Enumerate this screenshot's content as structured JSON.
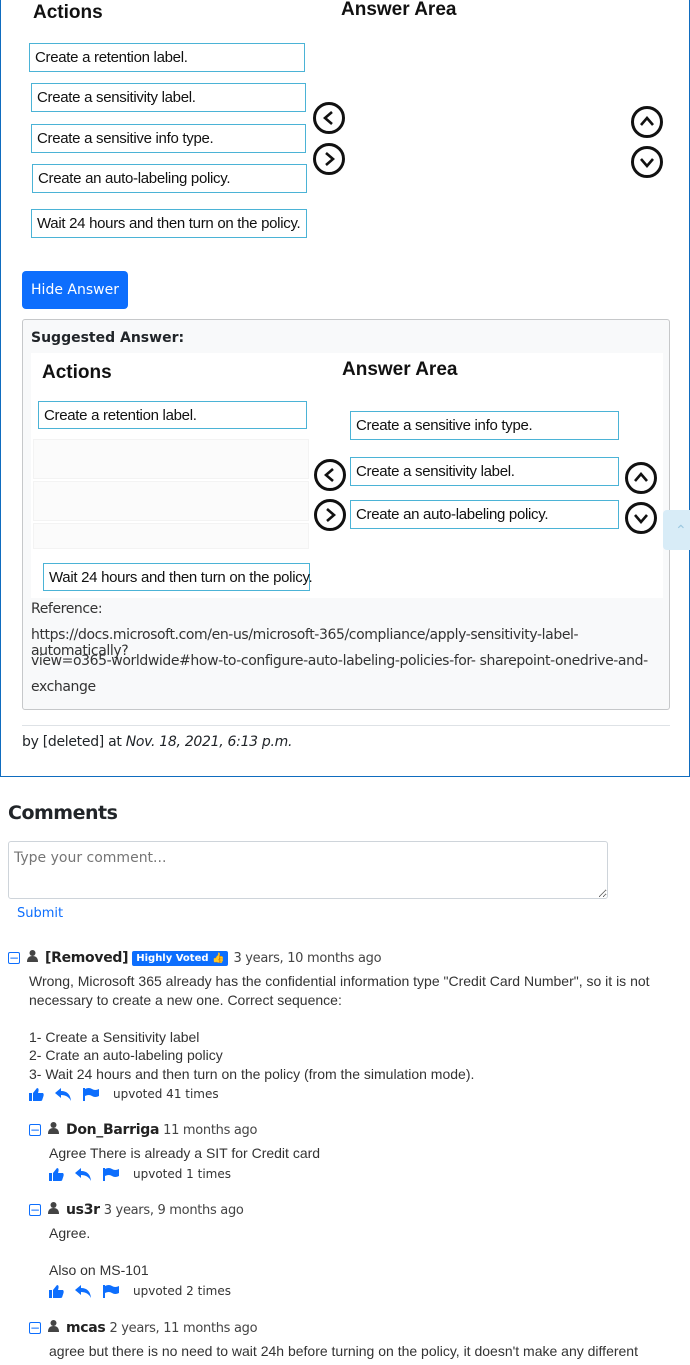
{
  "question": {
    "actions_header": "Actions",
    "answer_area_header": "Answer Area",
    "actions": [
      "Create a retention label.",
      "Create a sensitivity label.",
      "Create a sensitive info type.",
      "Create an auto-labeling policy.",
      "Wait 24 hours and then turn on the policy."
    ]
  },
  "hide_answer_label": "Hide Answer",
  "suggested": {
    "label": "Suggested Answer:",
    "actions_header": "Actions",
    "answer_area_header": "Answer Area",
    "remaining_actions": [
      "Create a retention label.",
      "Wait 24 hours and then turn on the policy."
    ],
    "answer_items": [
      "Create a sensitive info type.",
      "Create a sensitivity label.",
      "Create an auto-labeling policy."
    ],
    "reference_label": "Reference:",
    "reference_lines": [
      "https://docs.microsoft.com/en-us/microsoft-365/compliance/apply-sensitivity-label-automatically?",
      "view=o365-worldwide#how-to-configure-auto-labeling-policies-for- sharepoint-onedrive-and-",
      "exchange"
    ]
  },
  "byline": {
    "prefix": "by [deleted] at",
    "date": "Nov. 18, 2021, 6:13 p.m."
  },
  "comments": {
    "title": "Comments",
    "input_placeholder": "Type your comment...",
    "submit_label": "Submit",
    "items": [
      {
        "user": "[Removed]",
        "badge": "Highly Voted",
        "ago": "3 years, 10 months ago",
        "body": "Wrong, Microsoft 365 already has the confidential information type \"Credit Card Number\", so it is not necessary to create a new one. Correct sequence:\n\n1- Create a Sensitivity label\n2- Crate an auto-labeling policy\n3- Wait 24 hours and then turn on the policy (from the simulation mode).",
        "upvotes": "upvoted 41 times"
      },
      {
        "user": "Don_Barriga",
        "ago": "11 months ago",
        "body": "Agree There is already a SIT for Credit card",
        "upvotes": "upvoted 1 times"
      },
      {
        "user": "us3r",
        "ago": "3 years, 9 months ago",
        "body": "Agree.\n\nAlso on MS-101",
        "upvotes": "upvoted 2 times"
      },
      {
        "user": "mcas",
        "ago": "2 years, 11 months ago",
        "body": "agree but there is no need to wait 24h before turning on the policy, it doesn't make any different"
      }
    ]
  },
  "colors": {
    "accent": "#0d6efd",
    "box_border": "#4bb3d6",
    "card_border": "#0f6cbf"
  }
}
